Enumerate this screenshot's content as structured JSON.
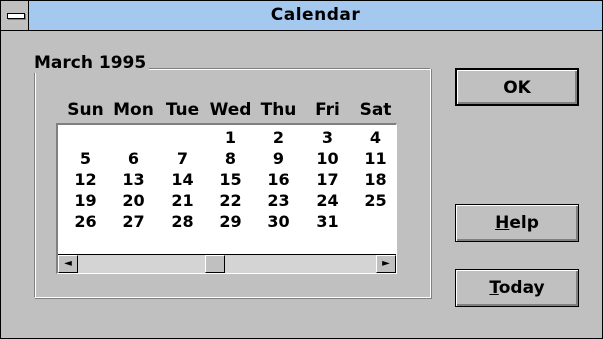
{
  "window": {
    "title": "Calendar"
  },
  "calendar": {
    "month_label": "March 1995",
    "weekdays": [
      "Sun",
      "Mon",
      "Tue",
      "Wed",
      "Thu",
      "Fri",
      "Sat"
    ],
    "weeks": [
      [
        "",
        "",
        "",
        "1",
        "2",
        "3",
        "4"
      ],
      [
        "5",
        "6",
        "7",
        "8",
        "9",
        "10",
        "11"
      ],
      [
        "12",
        "13",
        "14",
        "15",
        "16",
        "17",
        "18"
      ],
      [
        "19",
        "20",
        "21",
        "22",
        "23",
        "24",
        "25"
      ],
      [
        "26",
        "27",
        "28",
        "29",
        "30",
        "31",
        ""
      ]
    ]
  },
  "buttons": {
    "ok": "OK",
    "help_mnemonic": "H",
    "help_rest": "elp",
    "today_mnemonic": "T",
    "today_rest": "oday"
  },
  "scrollbar": {
    "left_arrow": "◄",
    "right_arrow": "►"
  }
}
